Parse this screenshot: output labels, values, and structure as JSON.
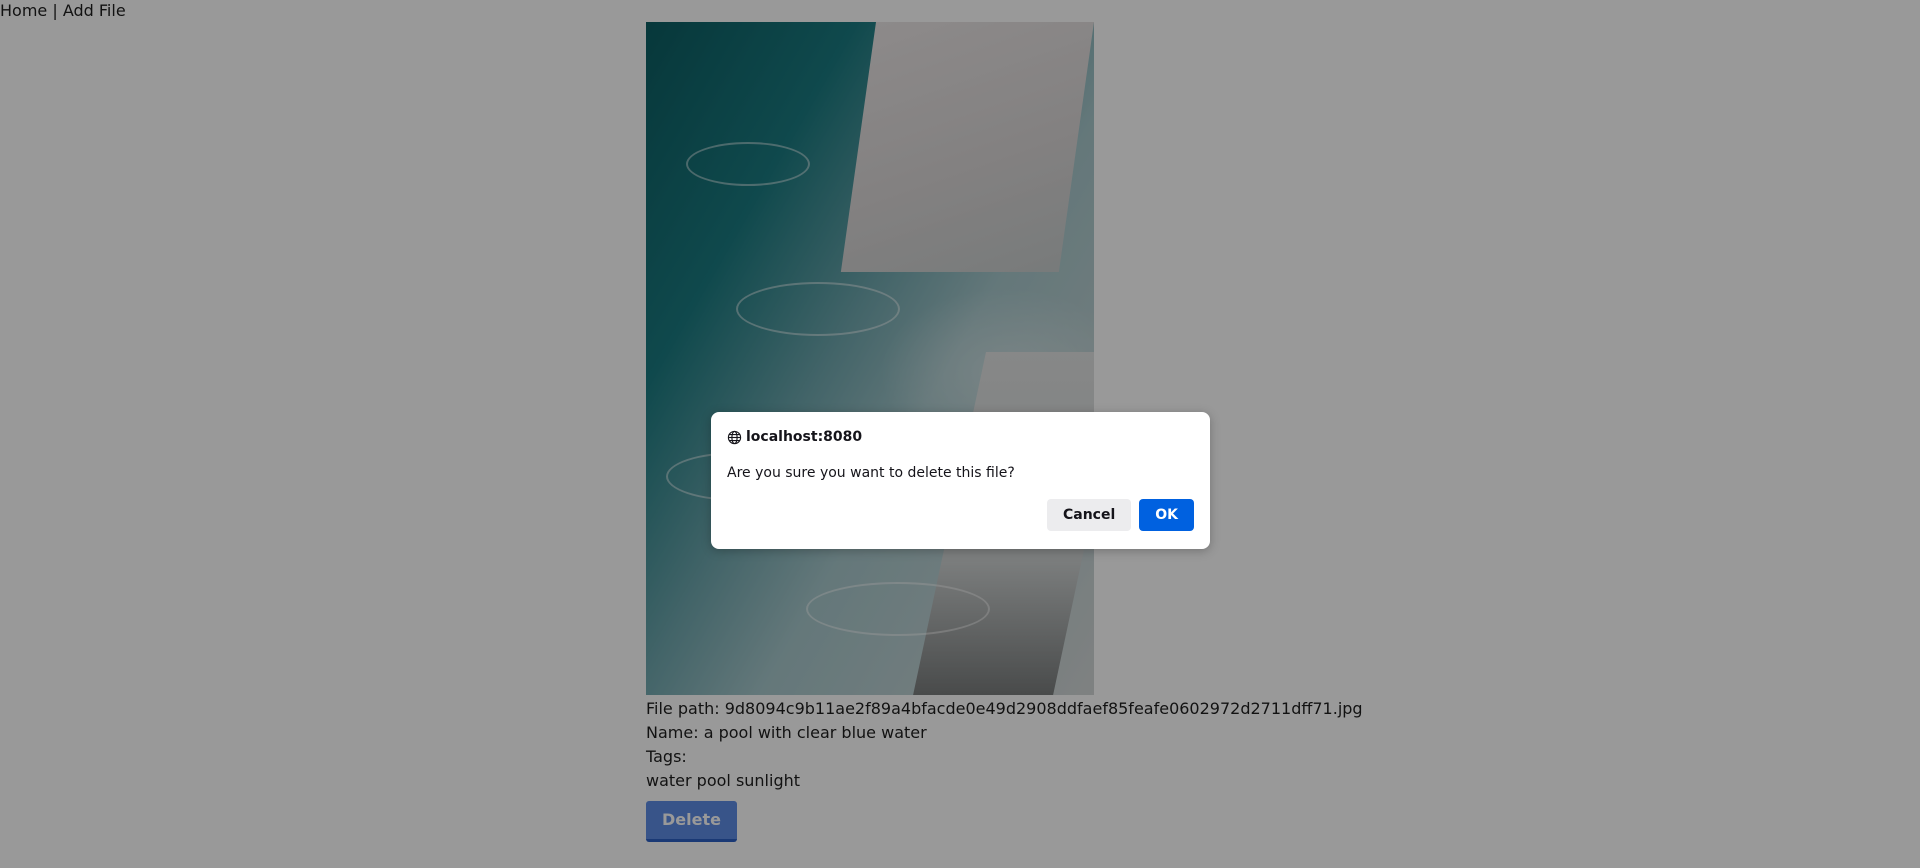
{
  "nav": {
    "home_label": "Home",
    "separator": "|",
    "add_file_label": "Add File"
  },
  "file": {
    "path_label": "File path:",
    "path_value": "9d8094c9b11ae2f89a4bfacde0e49d2908ddfaef85feafe0602972d2711dff71.jpg",
    "name_label": "Name:",
    "name_value": "a pool with clear blue water",
    "tags_label": "Tags:",
    "tags_value": "water pool sunlight",
    "delete_label": "Delete"
  },
  "dialog": {
    "origin": "localhost:8080",
    "message": "Are you sure you want to delete this file?",
    "cancel_label": "Cancel",
    "ok_label": "OK"
  },
  "colors": {
    "ok_button": "#0061e0",
    "delete_button": "#3273dc",
    "overlay": "rgba(0,0,0,0.4)"
  }
}
